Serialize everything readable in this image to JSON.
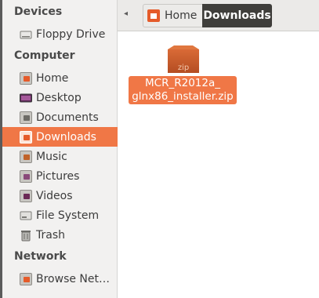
{
  "sidebar": {
    "devices_header": "Devices",
    "computer_header": "Computer",
    "network_header": "Network",
    "devices": [
      {
        "label": "Floppy Drive",
        "icon": "floppy-drive-icon"
      }
    ],
    "computer": [
      {
        "label": "Home",
        "icon": "home-folder-icon"
      },
      {
        "label": "Desktop",
        "icon": "desktop-icon"
      },
      {
        "label": "Documents",
        "icon": "documents-folder-icon"
      },
      {
        "label": "Downloads",
        "icon": "downloads-folder-icon",
        "active": true
      },
      {
        "label": "Music",
        "icon": "music-folder-icon"
      },
      {
        "label": "Pictures",
        "icon": "pictures-folder-icon"
      },
      {
        "label": "Videos",
        "icon": "videos-folder-icon"
      },
      {
        "label": "File System",
        "icon": "file-system-icon"
      },
      {
        "label": "Trash",
        "icon": "trash-icon"
      }
    ],
    "network": [
      {
        "label": "Browse Net…",
        "icon": "browse-network-icon"
      }
    ]
  },
  "breadcrumb": {
    "back_arrow": "◂",
    "home": "Home",
    "current": "Downloads"
  },
  "files": [
    {
      "name_line1": "MCR_R2012a_",
      "name_line2": "glnx86_installer.zip",
      "icon_text": "zip",
      "icon": "zip-archive-icon",
      "selected": true
    }
  ],
  "colors": {
    "accent": "#f07746",
    "active_crumb": "#3f3e3b",
    "sidebar_bg": "#f2f1f0"
  }
}
